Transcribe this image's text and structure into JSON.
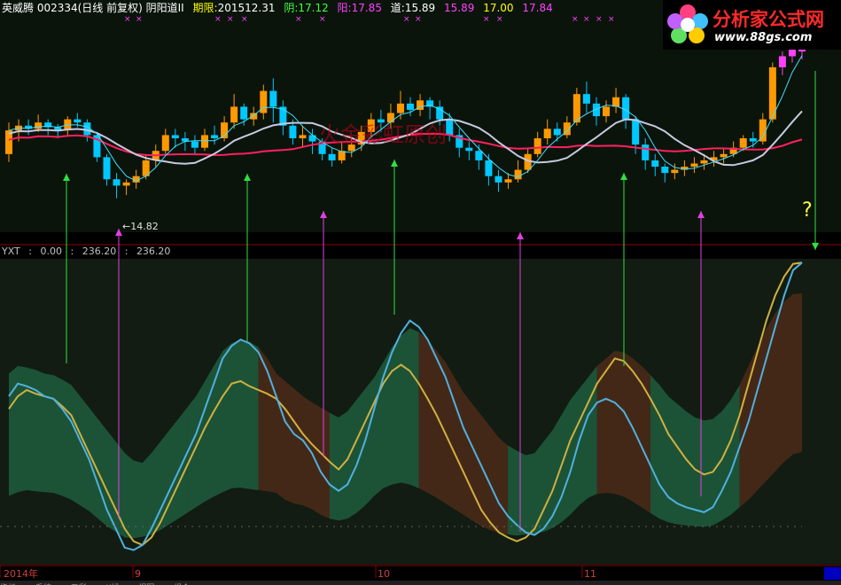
{
  "header": {
    "title": "英威腾 002334(日线 前复权) 阴阳道II",
    "period_label": "期限:",
    "period_value": "201512.31",
    "yin_label": "阴:",
    "yin_value": "17.12",
    "yang_label": "阳:",
    "yang_value": "17.85",
    "dao_label": "道:",
    "dao_values": [
      "15.89",
      "15.89",
      "17.00",
      "17.84"
    ]
  },
  "indicator": {
    "name": "YXT",
    "values": [
      ":",
      "0.00",
      ":",
      "236.20",
      ":",
      "236.20"
    ]
  },
  "logo": {
    "text": "分析家公式网",
    "url": "www.88gs.com"
  },
  "watermark": "火金彩虹原创",
  "bottom_tabs": [
    "指标",
    "系统",
    "五彩",
    "K线",
    "视图",
    "组合"
  ],
  "colors": {
    "up_candle": "#ff9900",
    "down_candle": "#00c8ff",
    "big_up": "#ff40ff",
    "ma_white": "#c8c8e0",
    "ma_pink": "#ff2060",
    "ma_cyan": "#40e0ff",
    "band_green": "#1e5a3c",
    "band_brown": "#4a2a18",
    "osc_cyan": "#50b0e0",
    "osc_yellow": "#d0b040",
    "arrow_green": "#30e040",
    "arrow_magenta": "#e040e0",
    "grid_red": "#8b0000"
  },
  "chart_data": [
    {
      "type": "candlestick",
      "title": "",
      "x_ticks": [
        "2014年",
        "9",
        "10",
        "11"
      ],
      "low_annotation": "14.82",
      "marker": "?",
      "series": [
        {
          "values": [
            [
              0.4,
              0.55,
              0.6,
              0.35
            ],
            [
              0.55,
              0.58,
              0.62,
              0.48
            ],
            [
              0.58,
              0.56,
              0.62,
              0.52
            ],
            [
              0.56,
              0.6,
              0.65,
              0.54
            ],
            [
              0.6,
              0.57,
              0.62,
              0.52
            ],
            [
              0.57,
              0.55,
              0.59,
              0.5
            ],
            [
              0.55,
              0.62,
              0.64,
              0.52
            ],
            [
              0.62,
              0.6,
              0.66,
              0.57
            ],
            [
              0.6,
              0.52,
              0.62,
              0.48
            ],
            [
              0.52,
              0.38,
              0.54,
              0.35
            ],
            [
              0.38,
              0.24,
              0.4,
              0.2
            ],
            [
              0.24,
              0.2,
              0.28,
              0.12
            ],
            [
              0.2,
              0.22,
              0.24,
              0.14
            ],
            [
              0.22,
              0.26,
              0.3,
              0.18
            ],
            [
              0.26,
              0.36,
              0.4,
              0.24
            ],
            [
              0.36,
              0.42,
              0.46,
              0.32
            ],
            [
              0.42,
              0.52,
              0.56,
              0.4
            ],
            [
              0.52,
              0.5,
              0.56,
              0.44
            ],
            [
              0.5,
              0.48,
              0.54,
              0.42
            ],
            [
              0.48,
              0.44,
              0.52,
              0.4
            ],
            [
              0.44,
              0.52,
              0.56,
              0.42
            ],
            [
              0.52,
              0.5,
              0.58,
              0.46
            ],
            [
              0.5,
              0.6,
              0.64,
              0.48
            ],
            [
              0.6,
              0.7,
              0.78,
              0.56
            ],
            [
              0.7,
              0.62,
              0.72,
              0.58
            ],
            [
              0.62,
              0.66,
              0.7,
              0.58
            ],
            [
              0.66,
              0.8,
              0.84,
              0.62
            ],
            [
              0.8,
              0.7,
              0.88,
              0.6
            ],
            [
              0.7,
              0.58,
              0.74,
              0.52
            ],
            [
              0.58,
              0.5,
              0.62,
              0.46
            ],
            [
              0.5,
              0.52,
              0.58,
              0.44
            ],
            [
              0.52,
              0.48,
              0.56,
              0.4
            ],
            [
              0.48,
              0.4,
              0.5,
              0.36
            ],
            [
              0.4,
              0.36,
              0.44,
              0.32
            ],
            [
              0.36,
              0.42,
              0.48,
              0.34
            ],
            [
              0.42,
              0.46,
              0.5,
              0.38
            ],
            [
              0.46,
              0.54,
              0.58,
              0.42
            ],
            [
              0.54,
              0.62,
              0.66,
              0.5
            ],
            [
              0.62,
              0.6,
              0.68,
              0.54
            ],
            [
              0.6,
              0.66,
              0.72,
              0.56
            ],
            [
              0.66,
              0.72,
              0.8,
              0.62
            ],
            [
              0.72,
              0.68,
              0.76,
              0.64
            ],
            [
              0.68,
              0.74,
              0.78,
              0.64
            ],
            [
              0.74,
              0.7,
              0.76,
              0.62
            ],
            [
              0.7,
              0.62,
              0.74,
              0.58
            ],
            [
              0.62,
              0.52,
              0.66,
              0.48
            ],
            [
              0.52,
              0.44,
              0.56,
              0.38
            ],
            [
              0.44,
              0.42,
              0.48,
              0.36
            ],
            [
              0.42,
              0.36,
              0.46,
              0.3
            ],
            [
              0.36,
              0.26,
              0.4,
              0.2
            ],
            [
              0.26,
              0.22,
              0.3,
              0.16
            ],
            [
              0.22,
              0.24,
              0.28,
              0.18
            ],
            [
              0.24,
              0.3,
              0.36,
              0.22
            ],
            [
              0.3,
              0.4,
              0.44,
              0.28
            ],
            [
              0.4,
              0.5,
              0.54,
              0.38
            ],
            [
              0.5,
              0.56,
              0.62,
              0.46
            ],
            [
              0.56,
              0.52,
              0.6,
              0.48
            ],
            [
              0.52,
              0.6,
              0.64,
              0.5
            ],
            [
              0.6,
              0.78,
              0.82,
              0.58
            ],
            [
              0.78,
              0.72,
              0.86,
              0.66
            ],
            [
              0.72,
              0.64,
              0.76,
              0.58
            ],
            [
              0.64,
              0.7,
              0.74,
              0.6
            ],
            [
              0.7,
              0.76,
              0.82,
              0.66
            ],
            [
              0.76,
              0.62,
              0.78,
              0.56
            ],
            [
              0.62,
              0.46,
              0.64,
              0.4
            ],
            [
              0.46,
              0.36,
              0.5,
              0.3
            ],
            [
              0.36,
              0.32,
              0.4,
              0.26
            ],
            [
              0.32,
              0.28,
              0.34,
              0.22
            ],
            [
              0.28,
              0.3,
              0.34,
              0.24
            ],
            [
              0.3,
              0.32,
              0.36,
              0.26
            ],
            [
              0.32,
              0.34,
              0.38,
              0.28
            ],
            [
              0.34,
              0.36,
              0.4,
              0.3
            ],
            [
              0.36,
              0.38,
              0.42,
              0.32
            ],
            [
              0.38,
              0.4,
              0.44,
              0.34
            ],
            [
              0.4,
              0.44,
              0.48,
              0.38
            ],
            [
              0.44,
              0.5,
              0.52,
              0.42
            ],
            [
              0.5,
              0.48,
              0.54,
              0.44
            ],
            [
              0.48,
              0.62,
              0.66,
              0.46
            ],
            [
              0.62,
              0.95,
              0.98,
              0.6
            ],
            [
              0.95,
              1.02,
              1.05,
              0.9
            ],
            [
              1.02,
              1.08,
              1.1,
              0.98
            ],
            [
              1.08,
              1.05,
              1.12,
              1.0
            ]
          ]
        }
      ]
    },
    {
      "type": "line",
      "title": "",
      "x_ticks": [
        "2014年",
        "9",
        "10",
        "11"
      ],
      "ylim": [
        0,
        236.2
      ],
      "series": [
        {
          "color": "#50b0e0",
          "values": [
            130,
            140,
            138,
            135,
            130,
            128,
            120,
            110,
            95,
            80,
            60,
            40,
            25,
            10,
            8,
            12,
            25,
            40,
            55,
            70,
            85,
            100,
            120,
            140,
            160,
            170,
            175,
            172,
            165,
            150,
            130,
            110,
            100,
            95,
            85,
            70,
            60,
            55,
            60,
            75,
            95,
            120,
            145,
            165,
            180,
            190,
            185,
            175,
            160,
            145,
            125,
            105,
            90,
            75,
            60,
            45,
            35,
            28,
            22,
            20,
            25,
            35,
            50,
            70,
            95,
            115,
            125,
            128,
            125,
            118,
            105,
            90,
            75,
            60,
            50,
            45,
            42,
            40,
            38,
            42,
            55,
            70,
            90,
            110,
            135,
            160,
            185,
            210,
            230,
            236
          ]
        },
        {
          "color": "#d0b040",
          "values": [
            120,
            130,
            135,
            132,
            130,
            128,
            122,
            115,
            100,
            85,
            70,
            55,
            40,
            25,
            15,
            12,
            18,
            30,
            45,
            60,
            75,
            90,
            105,
            118,
            130,
            140,
            142,
            138,
            135,
            132,
            128,
            120,
            110,
            100,
            92,
            85,
            78,
            72,
            80,
            95,
            110,
            125,
            140,
            150,
            155,
            150,
            140,
            128,
            115,
            100,
            85,
            70,
            55,
            40,
            30,
            22,
            18,
            15,
            18,
            25,
            40,
            55,
            75,
            95,
            110,
            125,
            140,
            150,
            160,
            158,
            150,
            140,
            128,
            115,
            100,
            90,
            80,
            72,
            68,
            70,
            80,
            95,
            115,
            140,
            165,
            190,
            210,
            225,
            235,
            236
          ]
        }
      ]
    }
  ]
}
